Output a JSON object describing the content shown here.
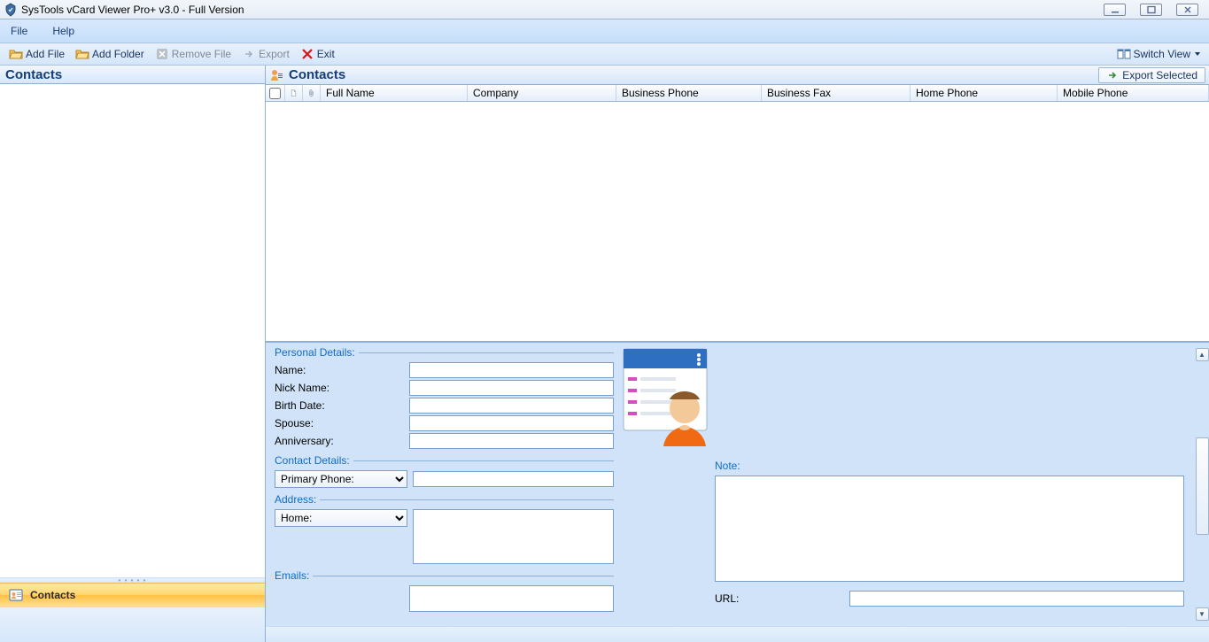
{
  "title": "SysTools vCard Viewer Pro+ v3.0 - Full Version",
  "menu": {
    "file": "File",
    "help": "Help"
  },
  "toolbar": {
    "add_file": "Add File",
    "add_folder": "Add Folder",
    "remove_file": "Remove File",
    "export": "Export",
    "exit": "Exit",
    "switch_view": "Switch View"
  },
  "left": {
    "title": "Contacts",
    "selector": "Contacts"
  },
  "grid": {
    "title": "Contacts",
    "export_selected": "Export Selected",
    "cols": {
      "full": "Full Name",
      "comp": "Company",
      "bphone": "Business Phone",
      "bfax": "Business Fax",
      "hphone": "Home Phone",
      "mphone": "Mobile Phone"
    }
  },
  "details": {
    "personal": {
      "legend": "Personal Details:",
      "name": "Name:",
      "nick": "Nick Name:",
      "birth": "Birth Date:",
      "spouse": "Spouse:",
      "anniv": "Anniversary:"
    },
    "contact": {
      "legend": "Contact Details:",
      "primary_phone": "Primary Phone:"
    },
    "address": {
      "legend": "Address:",
      "home": "Home:"
    },
    "emails": {
      "legend": "Emails:"
    },
    "note": {
      "legend": "Note:"
    },
    "url": "URL:"
  }
}
